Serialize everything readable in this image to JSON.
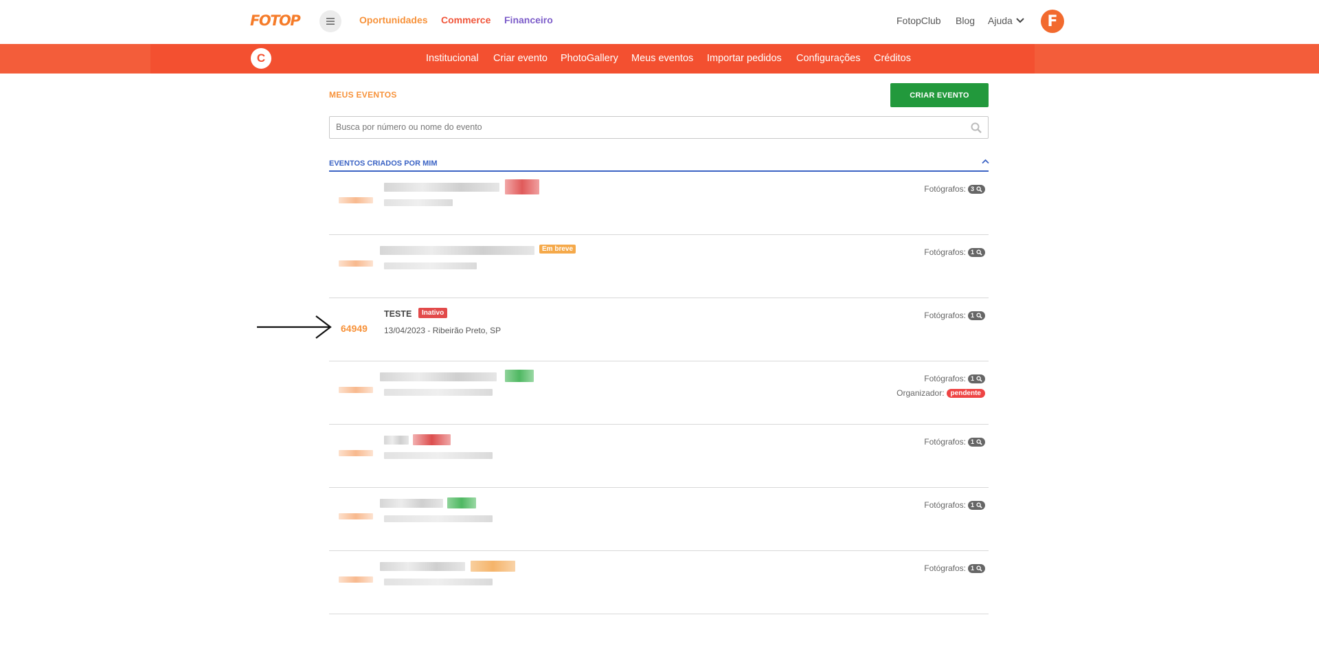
{
  "header": {
    "logo": "FOTOP",
    "nav": [
      {
        "label": "Oportunidades",
        "color": "#f7923a"
      },
      {
        "label": "Commerce",
        "color": "#f0553a"
      },
      {
        "label": "Financeiro",
        "color": "#7c5cc9"
      }
    ],
    "right": [
      "FotopClub",
      "Blog",
      "Ajuda"
    ],
    "avatar_letter": "F"
  },
  "subnav": {
    "badge_letter": "C",
    "links": [
      "Institucional",
      "Criar evento",
      "PhotoGallery",
      "Meus eventos",
      "Importar pedidos",
      "Configurações",
      "Créditos"
    ]
  },
  "main": {
    "title": "MEUS EVENTOS",
    "create_button": "CRIAR EVENTO",
    "search_placeholder": "Busca por número ou nome do evento",
    "section_title": "EVENTOS CRIADOS POR MIM",
    "fotografos_label": "Fotógrafos:",
    "organizador_label": "Organizador:",
    "events": [
      {
        "number": "",
        "name": "",
        "status": "",
        "status_color": "#e05a5a",
        "meta": "",
        "fotografos": "3"
      },
      {
        "number": "",
        "name": "",
        "status": "Em breve",
        "status_color": "#f5a94a",
        "meta": "",
        "fotografos": "1"
      },
      {
        "number": "64949",
        "name": "TESTE",
        "status": "Inativo",
        "status_color": "#e24a4a",
        "meta": "13/04/2023 - Ribeirão Preto, SP",
        "fotografos": "1"
      },
      {
        "number": "",
        "name": "",
        "status": "",
        "status_color": "#5dbb6a",
        "meta": "",
        "fotografos": "1",
        "organizador": "pendente"
      },
      {
        "number": "",
        "name": "",
        "status": "",
        "status_color": "#e05a5a",
        "meta": "",
        "fotografos": "1"
      },
      {
        "number": "",
        "name": "",
        "status": "",
        "status_color": "#5dbb6a",
        "meta": "",
        "fotografos": "1"
      },
      {
        "number": "",
        "name": "",
        "status": "",
        "status_color": "#f5b46a",
        "meta": "",
        "fotografos": "1"
      }
    ]
  }
}
